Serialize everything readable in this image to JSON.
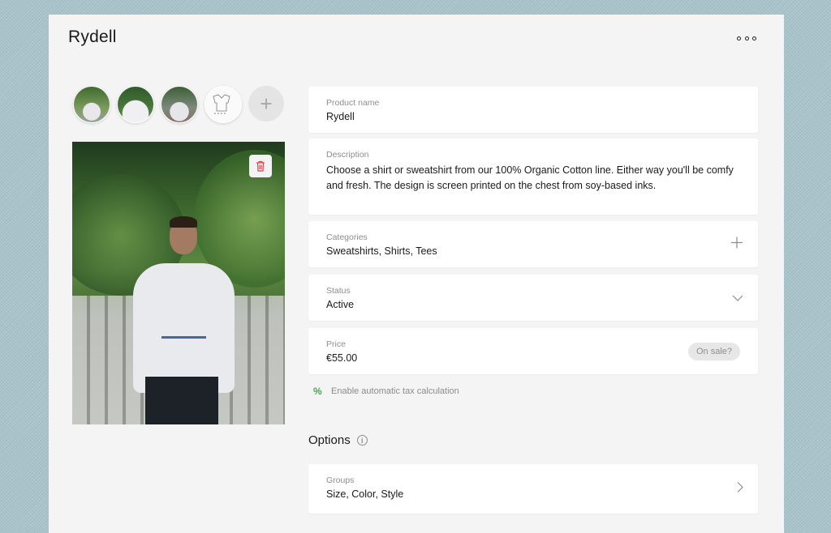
{
  "product": {
    "title": "Rydell"
  },
  "header": {
    "more_icon": "more-horizontal-icon"
  },
  "thumbnails": [
    {
      "name": "thumbnail-1"
    },
    {
      "name": "thumbnail-2"
    },
    {
      "name": "thumbnail-3"
    },
    {
      "name": "thumbnail-sketch"
    }
  ],
  "add_image_glyph": "+",
  "fields": {
    "product_name": {
      "label": "Product name",
      "value": "Rydell"
    },
    "description": {
      "label": "Description",
      "value": "Choose a shirt or sweatshirt from our 100% Organic Cotton line. Either way you'll be comfy and fresh. The design is screen printed on the chest from soy-based inks."
    },
    "categories": {
      "label": "Categories",
      "value": "Sweatshirts, Shirts, Tees"
    },
    "status": {
      "label": "Status",
      "value": "Active"
    },
    "price": {
      "label": "Price",
      "value": "€55.00",
      "sale_label": "On sale?"
    }
  },
  "tax": {
    "label": "Enable automatic tax calculation",
    "icon_glyph": "%"
  },
  "options": {
    "title": "Options",
    "info_glyph": "i",
    "groups": {
      "label": "Groups",
      "value": "Size, Color, Style"
    }
  },
  "colors": {
    "background": "#a9c4cb",
    "panel": "#f4f4f4",
    "accent_green": "#3fa74a",
    "delete_red": "#e0424a"
  }
}
